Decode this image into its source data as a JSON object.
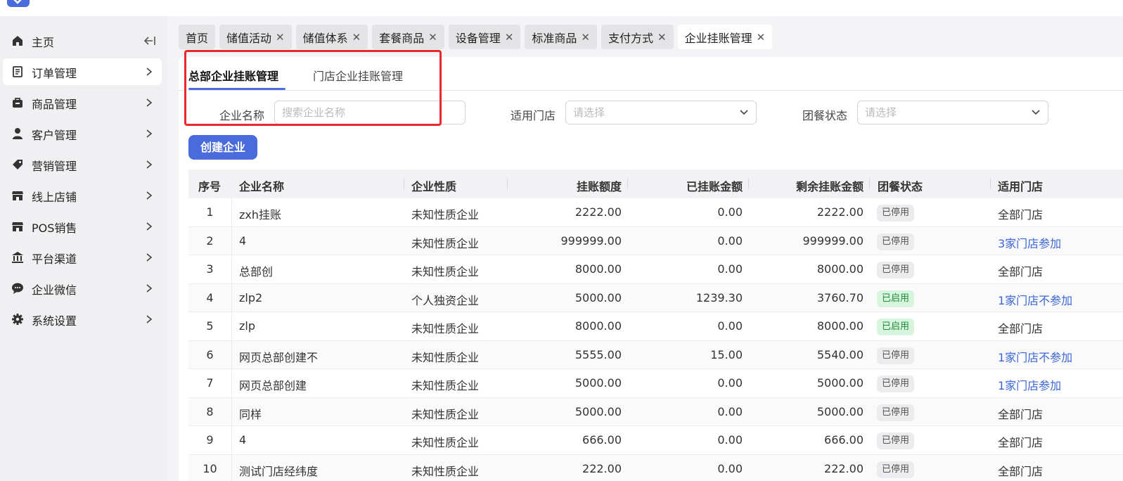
{
  "sidebar": {
    "items": [
      {
        "label": "主页",
        "icon": "home-icon",
        "active": false
      },
      {
        "label": "订单管理",
        "icon": "order-icon",
        "active": true
      },
      {
        "label": "商品管理",
        "icon": "bag-icon",
        "active": false
      },
      {
        "label": "客户管理",
        "icon": "user-icon",
        "active": false
      },
      {
        "label": "营销管理",
        "icon": "tag-icon",
        "active": false
      },
      {
        "label": "线上店铺",
        "icon": "store-icon",
        "active": false
      },
      {
        "label": "POS销售",
        "icon": "pos-store-icon",
        "active": false
      },
      {
        "label": "平台渠道",
        "icon": "bank-icon",
        "active": false
      },
      {
        "label": "企业微信",
        "icon": "chat-icon",
        "active": false
      },
      {
        "label": "系统设置",
        "icon": "gear-icon",
        "active": false
      }
    ]
  },
  "tabs": [
    {
      "label": "首页",
      "closable": false
    },
    {
      "label": "储值活动",
      "closable": true
    },
    {
      "label": "储值体系",
      "closable": true
    },
    {
      "label": "套餐商品",
      "closable": true
    },
    {
      "label": "设备管理",
      "closable": true
    },
    {
      "label": "标准商品",
      "closable": true
    },
    {
      "label": "支付方式",
      "closable": true
    },
    {
      "label": "企业挂账管理",
      "closable": true,
      "active": true
    }
  ],
  "subtabs": {
    "hq": "总部企业挂账管理",
    "store": "门店企业挂账管理"
  },
  "filters": {
    "company_label": "企业名称",
    "company_placeholder": "搜索企业名称",
    "store_label": "适用门店",
    "store_placeholder": "请选择",
    "status_label": "团餐状态",
    "status_placeholder": "请选择"
  },
  "create_button": "创建企业",
  "table": {
    "headers": [
      "序号",
      "企业名称",
      "企业性质",
      "挂账额度",
      "已挂账金额",
      "剩余挂账金额",
      "团餐状态",
      "适用门店"
    ],
    "rows": [
      {
        "no": "1",
        "name": "zxh挂账",
        "type": "未知性质企业",
        "limit": "2222.00",
        "used": "0.00",
        "remain": "2222.00",
        "status": "已停用",
        "status_on": false,
        "store": "全部门店",
        "store_link": false
      },
      {
        "no": "2",
        "name": "4",
        "type": "未知性质企业",
        "limit": "999999.00",
        "used": "0.00",
        "remain": "999999.00",
        "status": "已停用",
        "status_on": false,
        "store": "3家门店参加",
        "store_link": true
      },
      {
        "no": "3",
        "name": "总部创",
        "type": "未知性质企业",
        "limit": "8000.00",
        "used": "0.00",
        "remain": "8000.00",
        "status": "已停用",
        "status_on": false,
        "store": "全部门店",
        "store_link": false
      },
      {
        "no": "4",
        "name": "zlp2",
        "type": "个人独资企业",
        "limit": "5000.00",
        "used": "1239.30",
        "remain": "3760.70",
        "status": "已启用",
        "status_on": true,
        "store": "1家门店不参加",
        "store_link": true
      },
      {
        "no": "5",
        "name": "zlp",
        "type": "未知性质企业",
        "limit": "8000.00",
        "used": "0.00",
        "remain": "8000.00",
        "status": "已启用",
        "status_on": true,
        "store": "全部门店",
        "store_link": false
      },
      {
        "no": "6",
        "name": "网页总部创建不",
        "type": "未知性质企业",
        "limit": "5555.00",
        "used": "15.00",
        "remain": "5540.00",
        "status": "已停用",
        "status_on": false,
        "store": "1家门店不参加",
        "store_link": true
      },
      {
        "no": "7",
        "name": "网页总部创建",
        "type": "未知性质企业",
        "limit": "5000.00",
        "used": "0.00",
        "remain": "5000.00",
        "status": "已停用",
        "status_on": false,
        "store": "1家门店参加",
        "store_link": true
      },
      {
        "no": "8",
        "name": "同样",
        "type": "未知性质企业",
        "limit": "5000.00",
        "used": "0.00",
        "remain": "5000.00",
        "status": "已停用",
        "status_on": false,
        "store": "全部门店",
        "store_link": false
      },
      {
        "no": "9",
        "name": "4",
        "type": "未知性质企业",
        "limit": "666.00",
        "used": "0.00",
        "remain": "666.00",
        "status": "已停用",
        "status_on": false,
        "store": "全部门店",
        "store_link": false
      },
      {
        "no": "10",
        "name": "测试门店经纬度",
        "type": "未知性质企业",
        "limit": "222.00",
        "used": "0.00",
        "remain": "222.00",
        "status": "已停用",
        "status_on": false,
        "store": "全部门店",
        "store_link": false
      }
    ]
  },
  "colors": {
    "accent": "#4a6bdc",
    "highlight_box": "#e8282a",
    "link": "#3b66d6",
    "enabled_badge": "#d6f5dc"
  }
}
